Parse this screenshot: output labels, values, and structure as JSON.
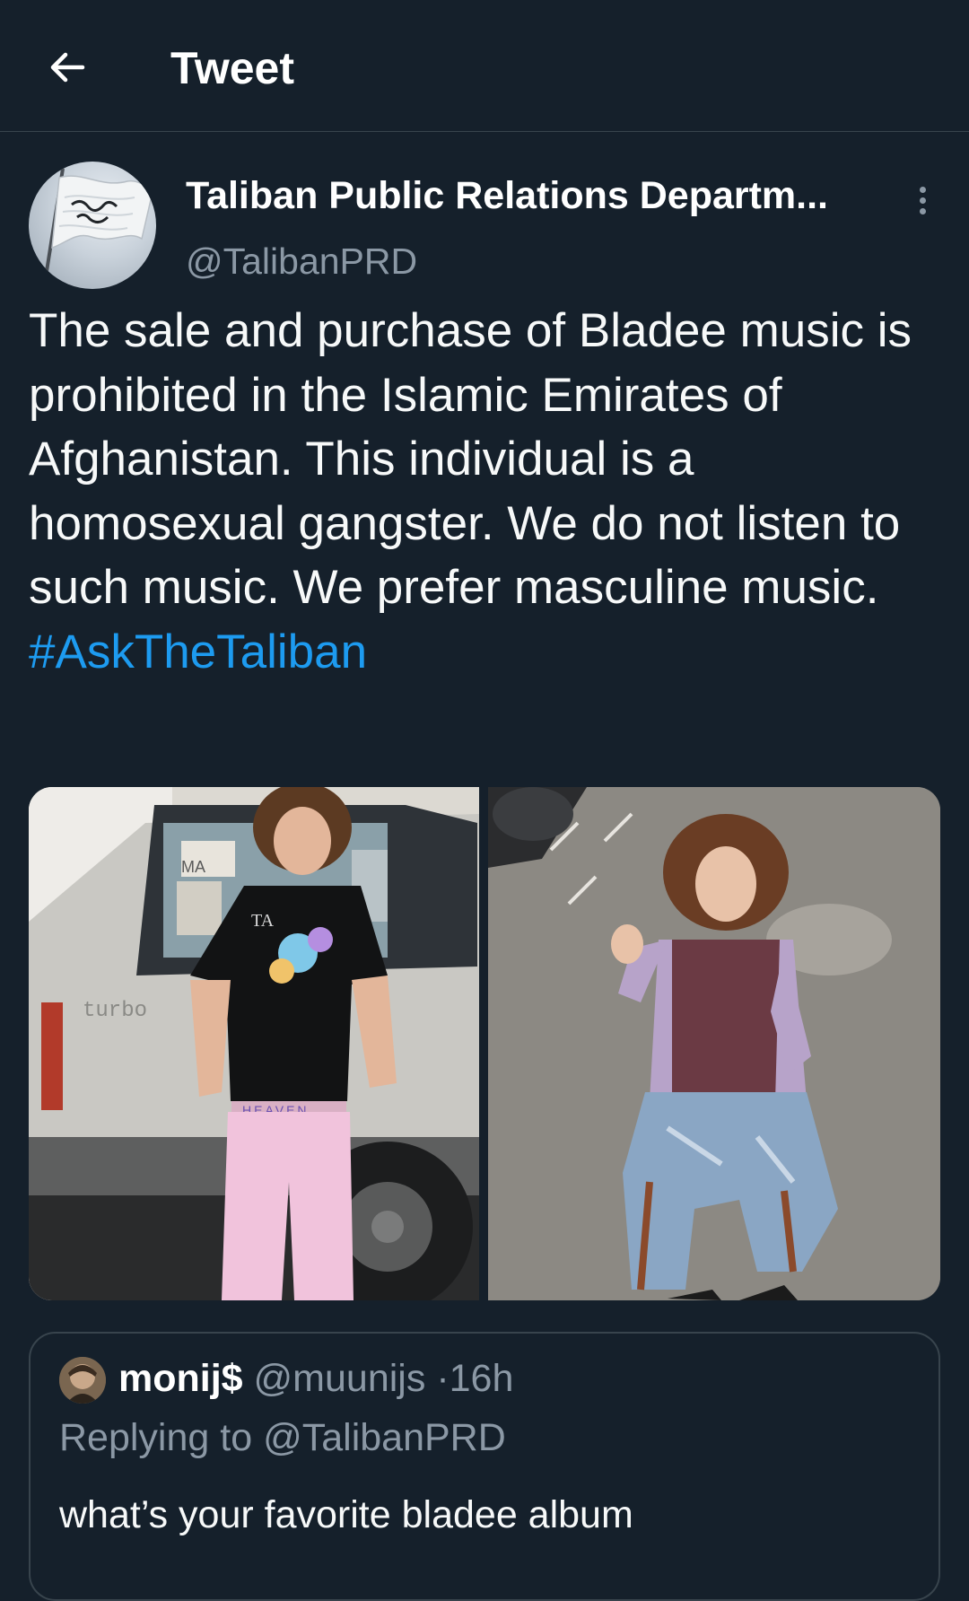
{
  "header": {
    "title": "Tweet",
    "back_icon": "arrow-left-icon"
  },
  "tweet": {
    "author": {
      "display_name": "Taliban Public Relations Departm...",
      "handle": "@TalibanPRD",
      "avatar": "flag-avatar"
    },
    "more_icon": "more-vertical-icon",
    "text": "The sale and purchase of Bladee music is prohibited in the Islamic Emirates of Afghanistan. This individual is a homosexual gangster. We do not listen to such music. We prefer masculine music.",
    "hashtag": "#AskTheTaliban",
    "media": {
      "photo_1": {
        "car_badge": "turbo",
        "sticker_text": "MA",
        "belt_text": "HEAVEN"
      },
      "photo_2": {}
    }
  },
  "quoted_tweet": {
    "display_name": "monij$",
    "handle": "@muunijs",
    "separator": "·",
    "time": "16h",
    "replying_to": "Replying to @TalibanPRD",
    "text": "what’s your favorite bladee album"
  },
  "colors": {
    "background": "#15202b",
    "text_primary": "#f7f9f9",
    "text_secondary": "#8b98a5",
    "accent": "#1d9bf0",
    "border": "#38444d"
  }
}
